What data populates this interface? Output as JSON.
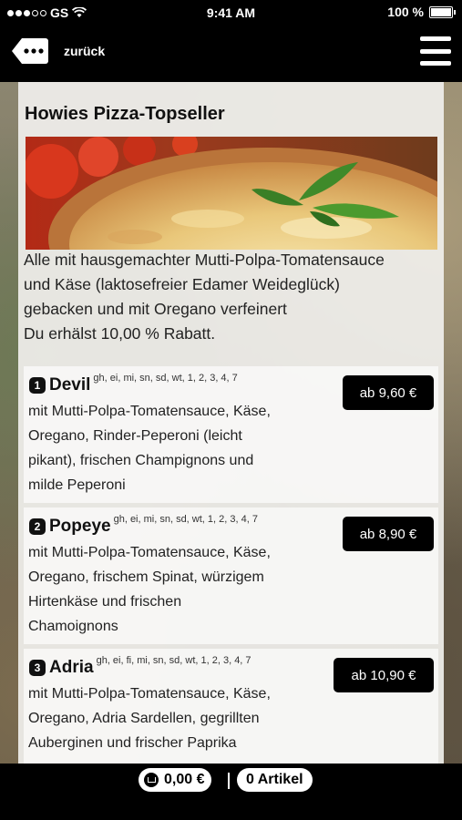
{
  "status": {
    "carrier": "GS",
    "time": "9:41 AM",
    "battery": "100 %"
  },
  "nav": {
    "back_label": "zurück",
    "back_icon": "back-tag-icon",
    "menu_icon": "hamburger-icon"
  },
  "section": {
    "title": "Howies Pizza-Topseller",
    "intro_lines": [
      "Alle mit hausgemachter Mutti-Polpa-Tomatensauce",
      "und Käse (laktosefreier Edamer Weideglück)",
      "gebacken und mit Oregano verfeinert",
      "Du erhälst 10,00 % Rabatt."
    ]
  },
  "items": [
    {
      "number": "1",
      "name": "Devil",
      "codes": "gh, ei, mi, sn, sd, wt, 1, 2, 3, 4, 7",
      "price": "ab 9,60 €",
      "desc_lines": [
        "mit Mutti-Polpa-Tomatensauce, Käse,",
        "Oregano, Rinder-Peperoni (leicht",
        "pikant), frischen Champignons und",
        "milde Peperoni"
      ]
    },
    {
      "number": "2",
      "name": "Popeye",
      "codes": "gh, ei, mi, sn, sd, wt, 1, 2, 3, 4, 7",
      "price": "ab 8,90 €",
      "desc_lines": [
        "mit Mutti-Polpa-Tomatensauce, Käse,",
        "Oregano, frischem Spinat, würzigem",
        "Hirtenkäse und frischen",
        "Chamoignons"
      ]
    },
    {
      "number": "3",
      "name": "Adria",
      "codes": "gh, ei, fi, mi, sn, sd, wt, 1, 2, 3, 4, 7",
      "price": "ab 10,90 €",
      "desc_lines": [
        "mit Mutti-Polpa-Tomatensauce, Käse,",
        "Oregano, Adria Sardellen, gegrillten",
        "Auberginen und frischer Paprika"
      ]
    }
  ],
  "cart": {
    "total": "0,00 €",
    "articles": "0 Artikel",
    "cart_icon": "cart-icon"
  }
}
